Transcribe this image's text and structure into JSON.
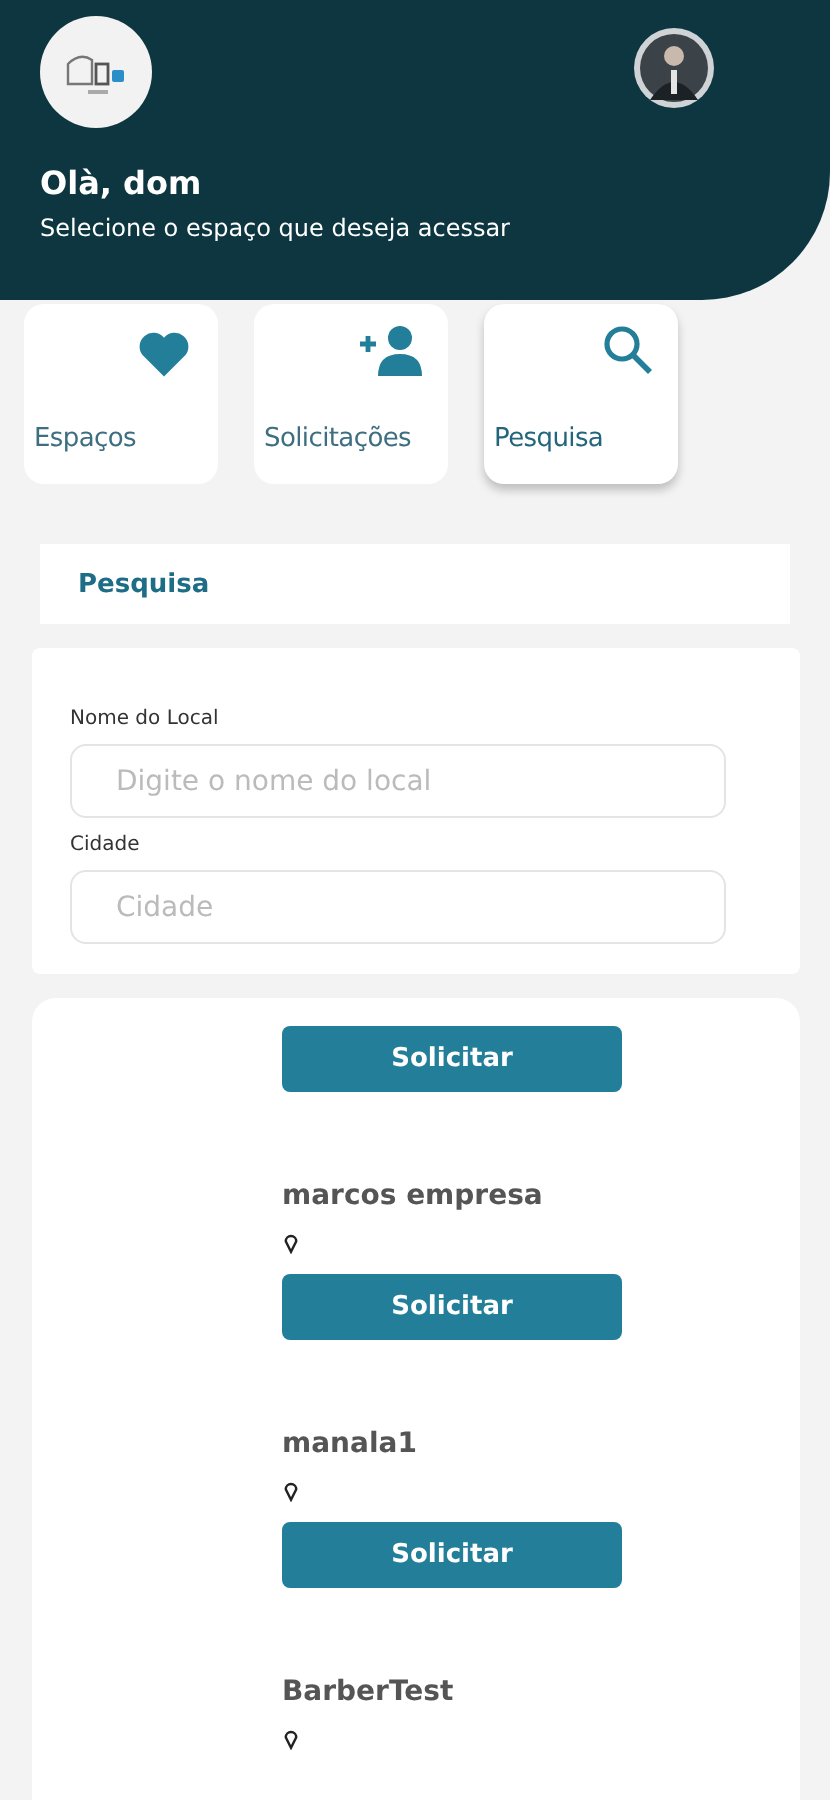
{
  "header": {
    "greeting": "Olà, dom",
    "subtitle": "Selecione o espaço que deseja acessar"
  },
  "tabs": [
    {
      "label": "Espaços",
      "selected": false
    },
    {
      "label": "Solicitações",
      "selected": false
    },
    {
      "label": "Pesquisa",
      "selected": true
    }
  ],
  "section_title": "Pesquisa",
  "form": {
    "fields": [
      {
        "label": "Nome do Local",
        "placeholder": "Digite o nome do local"
      },
      {
        "label": "Cidade",
        "placeholder": "Cidade"
      }
    ]
  },
  "results": [
    {
      "button": "Solicitar"
    },
    {
      "name": "marcos empresa",
      "button": "Solicitar"
    },
    {
      "name": "manala1",
      "button": "Solicitar"
    },
    {
      "name": "BarberTest"
    }
  ]
}
